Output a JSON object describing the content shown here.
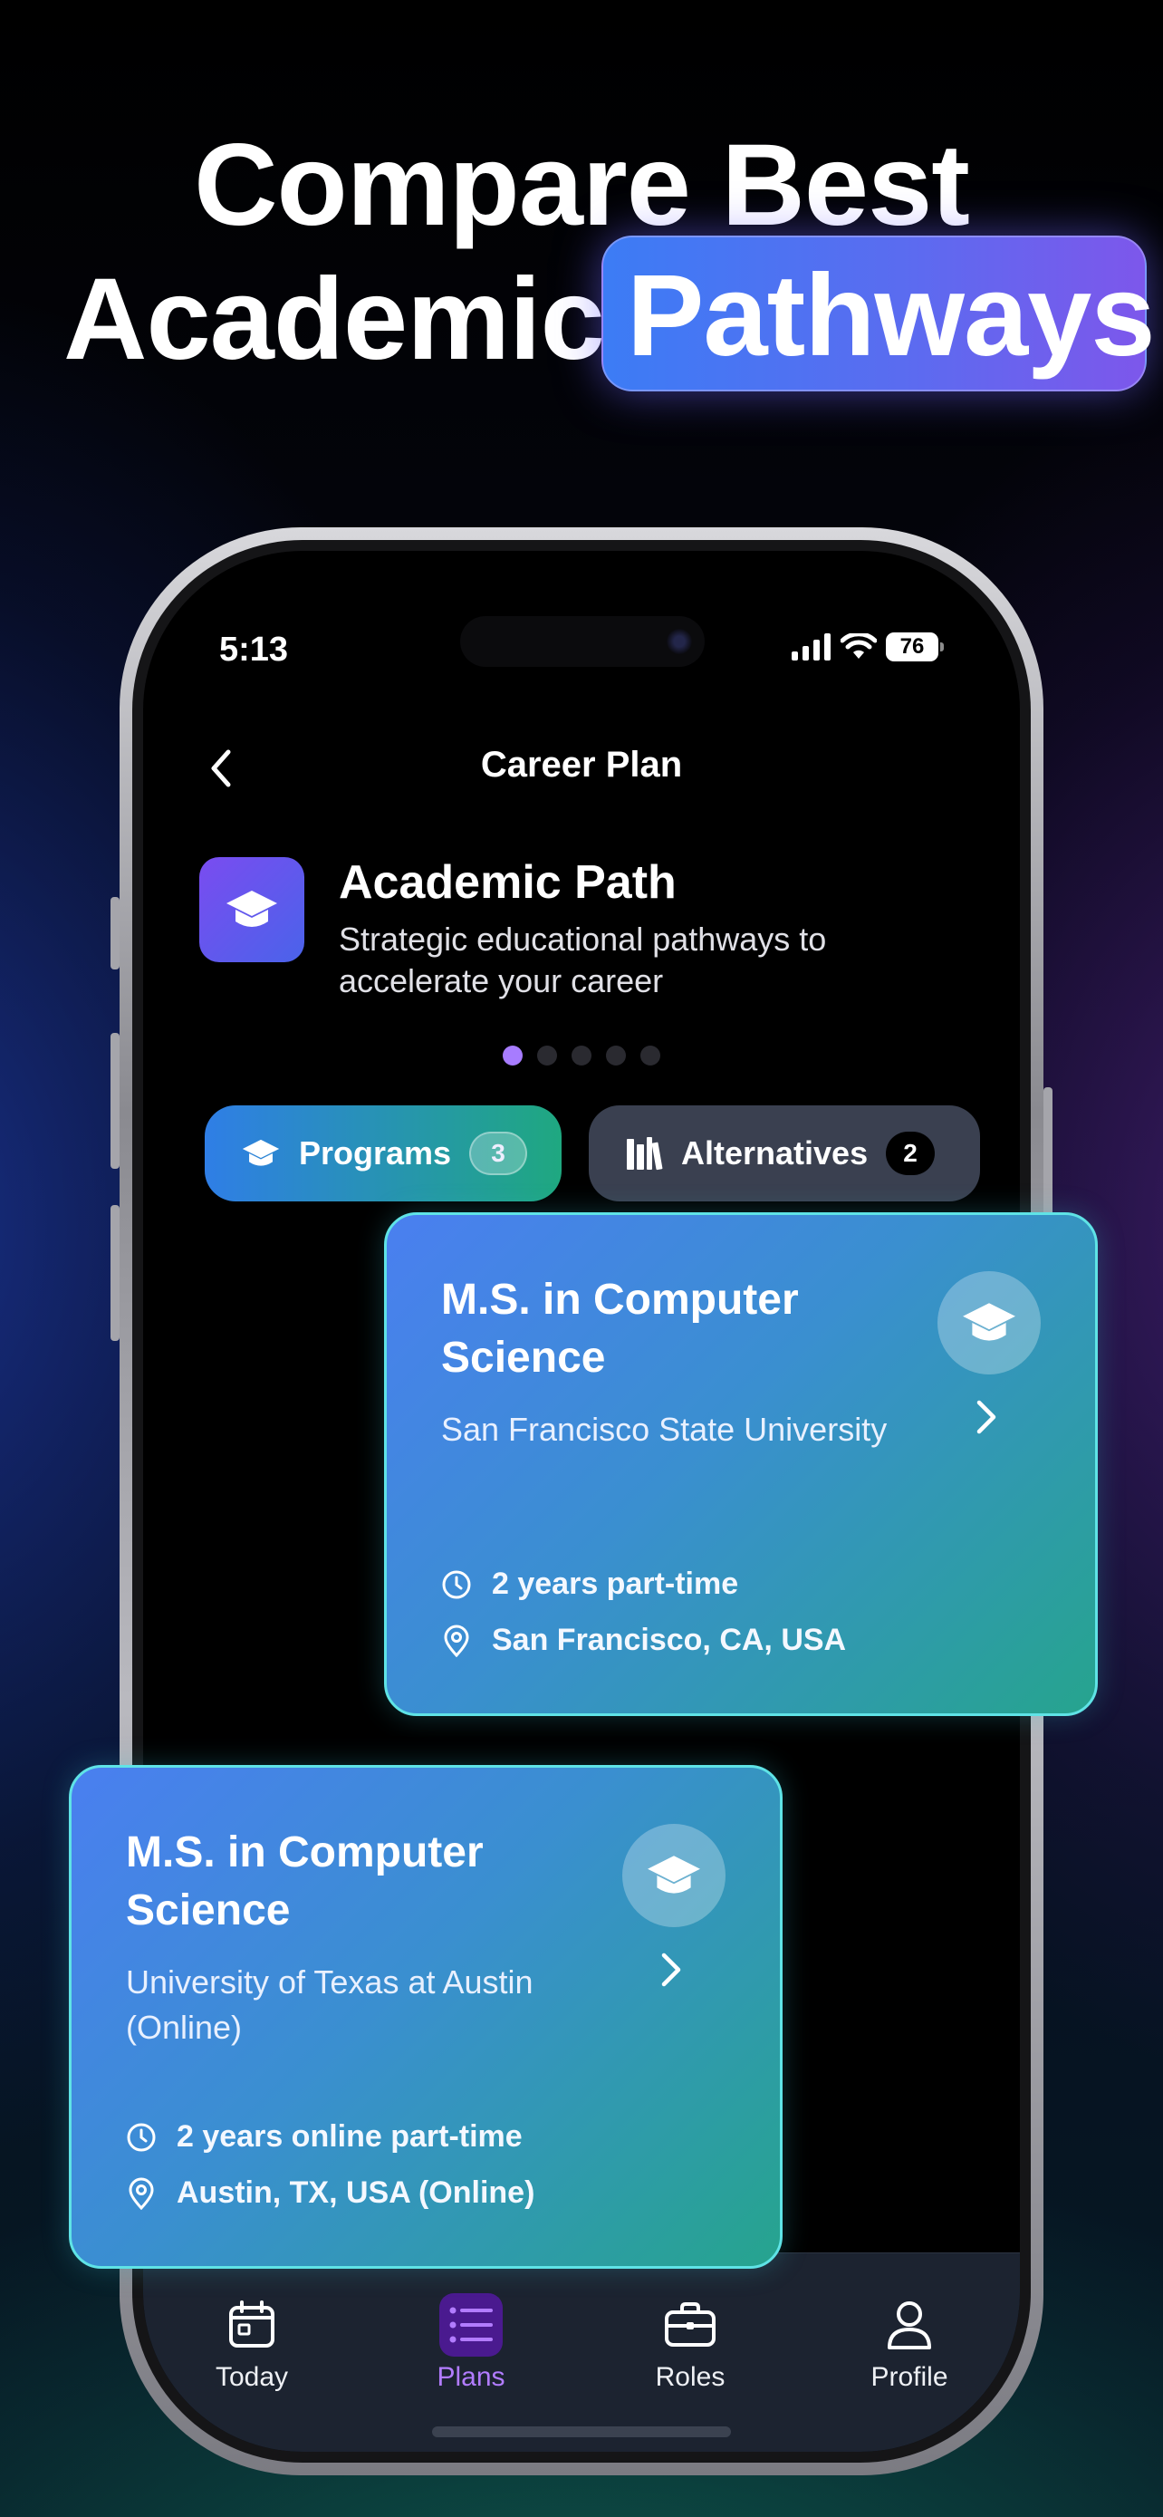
{
  "headline": {
    "line1": "Compare Best",
    "line2_plain": "Academic",
    "line2_highlight": "Pathways",
    "highlight_color": "#5a6cf0"
  },
  "status_bar": {
    "time": "5:13",
    "battery": "76"
  },
  "nav": {
    "title": "Career Plan",
    "back_icon": "chevron-left-icon"
  },
  "header": {
    "icon": "graduation-cap-icon",
    "title": "Academic Path",
    "subtitle": "Strategic educational pathways to accelerate your career"
  },
  "pager": {
    "count": 5,
    "active": 0
  },
  "tabs": [
    {
      "label": "Programs",
      "count": "3",
      "icon": "graduation-cap-icon",
      "active": true
    },
    {
      "label": "Alternatives",
      "count": "2",
      "icon": "books-icon",
      "active": false
    }
  ],
  "cards": [
    {
      "title": "M.S. in Computer Science",
      "university": "San Francisco State University",
      "duration": "2 years part-time",
      "location": "San Francisco, CA, USA"
    },
    {
      "title": "M.S. in Computer Science",
      "university": "University of Texas at Austin (Online)",
      "duration": "2 years online part-time",
      "location": "Austin, TX, USA (Online)"
    }
  ],
  "tab_bar": [
    {
      "label": "Today",
      "icon": "calendar-icon",
      "active": false
    },
    {
      "label": "Plans",
      "icon": "list-icon",
      "active": true
    },
    {
      "label": "Roles",
      "icon": "briefcase-icon",
      "active": false
    },
    {
      "label": "Profile",
      "icon": "person-icon",
      "active": false
    }
  ],
  "colors": {
    "accent_purple": "#a77cff",
    "card_border": "#5fe3e6",
    "tab_active_start": "#2f7ee6",
    "tab_active_end": "#1fa880"
  }
}
